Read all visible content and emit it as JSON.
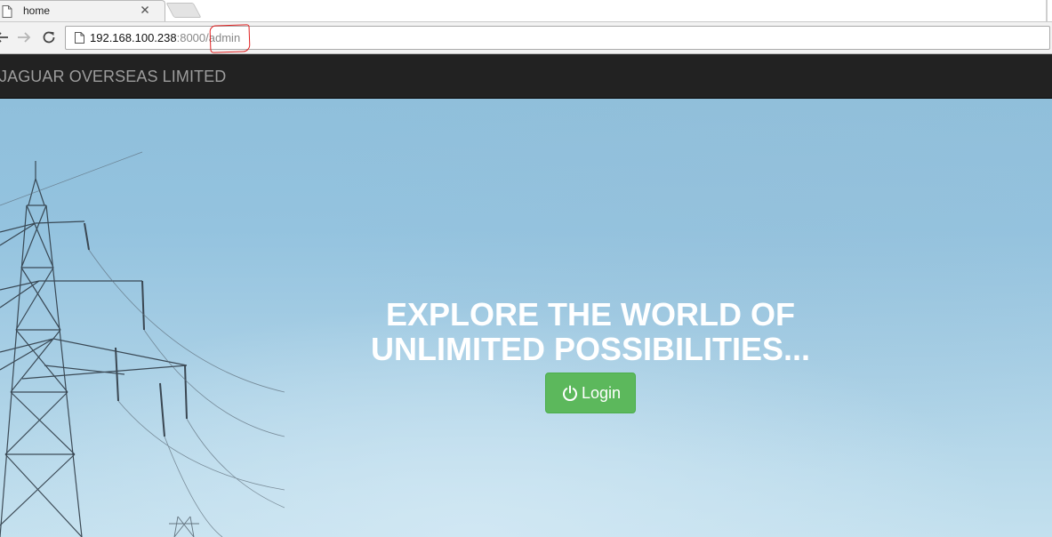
{
  "browser": {
    "tab": {
      "title": "home",
      "icon": "page-icon"
    },
    "address": {
      "host": "192.168.100.238",
      "port": ":8000",
      "path": "/admin"
    }
  },
  "site": {
    "brand": "JAGUAR OVERSEAS LIMITED",
    "hero": {
      "headline_line1": "EXPLORE THE WORLD OF",
      "headline_line2": "UNLIMITED POSSIBILITIES...",
      "login_label": "Login",
      "login_icon": "power-icon",
      "login_color": "#5cb85c"
    }
  }
}
